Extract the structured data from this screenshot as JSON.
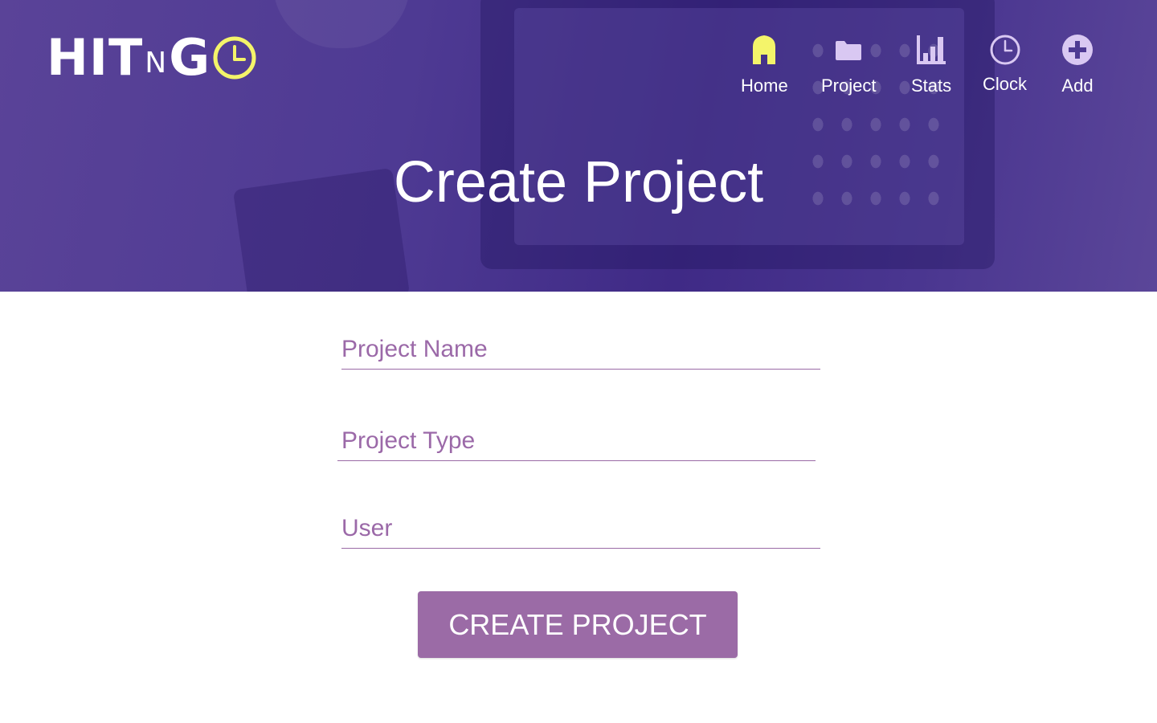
{
  "logo": {
    "part1": "HIT",
    "part2": "N",
    "part3": "G",
    "accent_color": "#f4f46a"
  },
  "nav": {
    "items": [
      {
        "label": "Home",
        "icon": "home-icon",
        "active": true
      },
      {
        "label": "Project",
        "icon": "folder-icon"
      },
      {
        "label": "Stats",
        "icon": "bar-chart-icon"
      },
      {
        "label": "Clock",
        "icon": "clock-icon"
      },
      {
        "label": "Add",
        "icon": "plus-circle-icon"
      }
    ],
    "active_color": "#f4f46a",
    "icon_color": "#d9c8f2"
  },
  "page": {
    "title": "Create Project"
  },
  "form": {
    "project_name": {
      "placeholder": "Project Name",
      "value": ""
    },
    "project_type": {
      "placeholder": "Project Type",
      "value": ""
    },
    "user": {
      "placeholder": "User",
      "value": ""
    },
    "submit_label": "CREATE PROJECT"
  },
  "colors": {
    "brand_purple": "#4e3a93",
    "button_purple": "#9b6ba6",
    "field_text": "#9b69a8"
  }
}
